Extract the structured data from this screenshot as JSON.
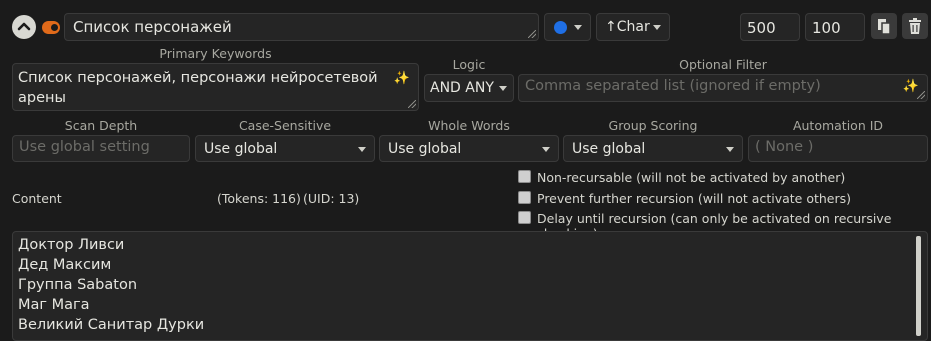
{
  "header": {
    "title": "Список персонажей",
    "role_label": "↑Char",
    "order_value": "500",
    "probability_value": "100",
    "status_color": "#1f6fe5",
    "toggle_color": "#e06a1a"
  },
  "keywords": {
    "primary_label": "Primary Keywords",
    "primary_value": "Список персонажей, персонажи нейросетевой арены",
    "logic_label": "Logic",
    "logic_value": "AND ANY",
    "optional_label": "Optional Filter",
    "optional_placeholder": "Comma separated list (ignored if empty)"
  },
  "settings": {
    "scan_depth_label": "Scan Depth",
    "scan_depth_placeholder": "Use global setting",
    "case_label": "Case-Sensitive",
    "case_value": "Use global",
    "whole_label": "Whole Words",
    "whole_value": "Use global",
    "group_label": "Group Scoring",
    "group_value": "Use global",
    "automation_label": "Automation ID",
    "automation_placeholder": "( None )"
  },
  "content": {
    "label": "Content",
    "tokens_text": "(Tokens: 116)",
    "uid_text": "(UID: 13)",
    "lines": [
      "Доктор Ливси",
      "Дед Максим",
      "Группа Sabaton",
      "Маг Мага",
      "Великий Санитар Дурки"
    ]
  },
  "options": {
    "non_recursable": "Non-recursable (will not be activated by another)",
    "prevent_recursion": "Prevent further recursion (will not activate others)",
    "delay_recursion": "Delay until recursion (can only be activated on recursive checking)"
  }
}
